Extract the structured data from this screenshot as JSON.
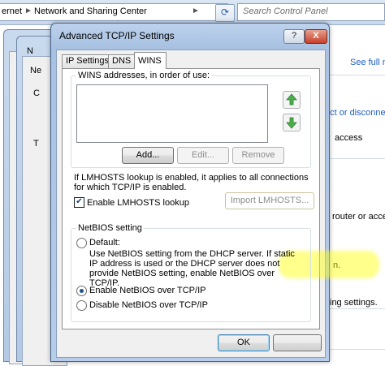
{
  "explorer": {
    "breadcrumb_prefix": "ernet",
    "breadcrumb_current": "Network and Sharing Center",
    "search_placeholder": "Search Control Panel",
    "right_links": [
      "See full m",
      "ect or disconne"
    ],
    "right_text": [
      "access",
      "router or acces",
      "n.",
      "ing settings."
    ],
    "ghost_letters": [
      "N",
      "Ne",
      "C",
      "T"
    ]
  },
  "dialog": {
    "title": "Advanced TCP/IP Settings",
    "help_glyph": "?",
    "close_glyph": "X",
    "tabs": [
      {
        "label": "IP Settings",
        "active": false
      },
      {
        "label": "DNS",
        "active": false
      },
      {
        "label": "WINS",
        "active": true
      }
    ],
    "wins": {
      "group_label": "WINS addresses, in order of use:",
      "buttons": {
        "add": "Add...",
        "edit": "Edit...",
        "remove": "Remove"
      },
      "lmhosts_note": "If LMHOSTS lookup is enabled, it applies to all connections for which TCP/IP is enabled.",
      "enable_lmhosts_label": "Enable LMHOSTS lookup",
      "enable_lmhosts_checked": true,
      "import_button": "Import LMHOSTS..."
    },
    "netbios": {
      "group_label": "NetBIOS setting",
      "options": [
        {
          "label": "Default:",
          "selected": false
        },
        {
          "label": "Enable NetBIOS over TCP/IP",
          "selected": true
        },
        {
          "label": "Disable NetBIOS over TCP/IP",
          "selected": false
        }
      ],
      "default_description": "Use NetBIOS setting from the DHCP server. If static IP address is used or the DHCP server does not provide NetBIOS setting, enable NetBIOS over TCP/IP."
    },
    "footer": {
      "ok": "OK"
    }
  }
}
